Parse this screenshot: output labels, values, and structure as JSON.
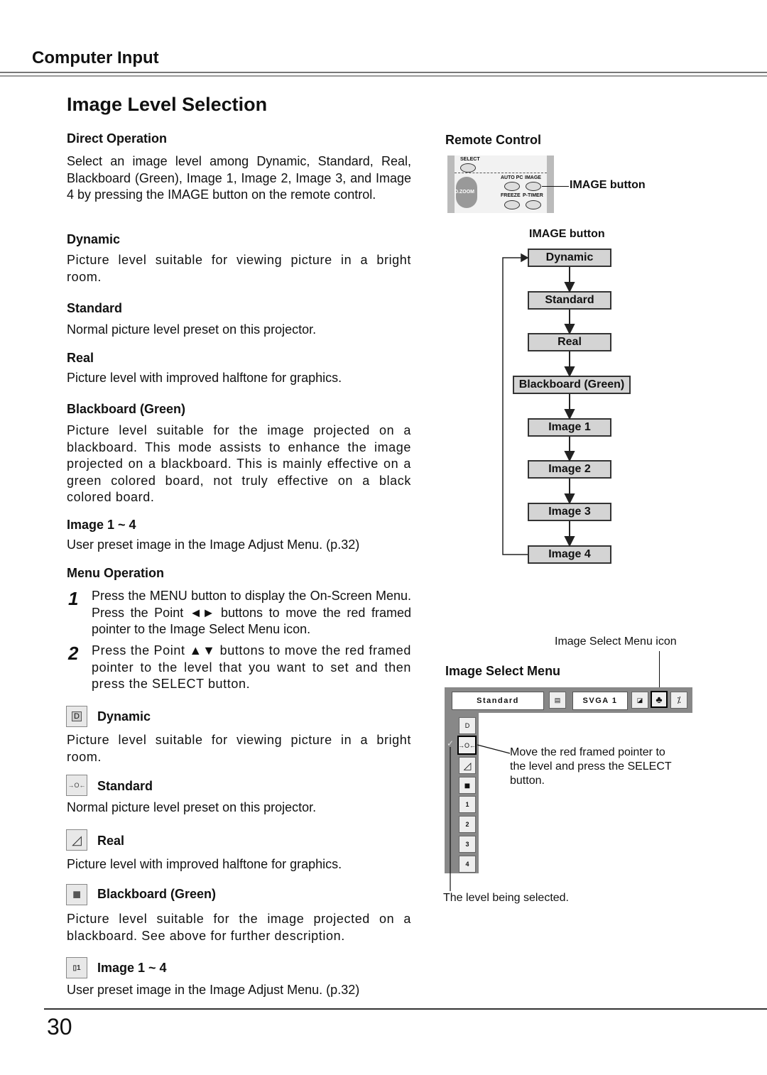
{
  "header": {
    "section": "Computer Input",
    "title": "Image Level Selection"
  },
  "direct": {
    "heading": "Direct Operation",
    "intro": "Select an image level among Dynamic, Standard, Real, Blackboard (Green), Image 1, Image 2, Image 3, and Image 4 by pressing the IMAGE button on the remote control.",
    "items": [
      {
        "name": "Dynamic",
        "desc": "Picture level suitable for viewing picture in a bright room."
      },
      {
        "name": "Standard",
        "desc": "Normal picture level preset on this projector."
      },
      {
        "name": "Real",
        "desc": "Picture level with improved halftone for graphics."
      },
      {
        "name": "Blackboard (Green)",
        "desc": "Picture level suitable for the image projected on a blackboard. This mode assists to enhance the image projected on a blackboard. This is mainly effective on a green colored board, not truly effective on a black colored board."
      },
      {
        "name": "Image 1 ~ 4",
        "desc": "User preset image in the Image Adjust Menu. (p.32)"
      }
    ]
  },
  "menu_op": {
    "heading": "Menu Operation",
    "steps": [
      {
        "num": "1",
        "text": "Press the MENU button to display the On-Screen Menu.  Press the Point ◄► buttons to move the red framed pointer to the Image Select Menu icon."
      },
      {
        "num": "2",
        "text": "Press the Point ▲▼ buttons to move the red framed pointer to the level that you want to set and then press the SELECT button."
      }
    ],
    "items": [
      {
        "name": "Dynamic",
        "icon": "dynamic-icon",
        "glyph": "D",
        "desc": "Picture level suitable for viewing picture in a bright room."
      },
      {
        "name": "Standard",
        "icon": "standard-icon",
        "glyph": "→O←",
        "desc": "Normal picture level preset on this projector."
      },
      {
        "name": "Real",
        "icon": "real-icon",
        "glyph": "◿",
        "desc": "Picture level with improved halftone for graphics."
      },
      {
        "name": "Blackboard (Green)",
        "icon": "blackboard-icon",
        "glyph": "■",
        "desc": "Picture level suitable for the image projected on a blackboard.  See above for further description."
      },
      {
        "name": "Image 1 ~ 4",
        "icon": "image-preset-icon",
        "glyph": "▯1",
        "desc": "User preset image in the Image Adjust Menu. (p.32)"
      }
    ]
  },
  "remote": {
    "heading": "Remote Control",
    "labels": [
      "SELECT",
      "AUTO PC",
      "IMAGE",
      "D.ZOOM",
      "FREEZE",
      "P-TIMER"
    ],
    "callout": "IMAGE button"
  },
  "flow": {
    "heading": "IMAGE button",
    "steps": [
      "Dynamic",
      "Standard",
      "Real",
      "Blackboard (Green)",
      "Image 1",
      "Image 2",
      "Image 3",
      "Image 4"
    ]
  },
  "osd": {
    "heading": "Image Select Menu",
    "icon_callout": "Image Select Menu icon",
    "mode_field": "Standard",
    "signal_field": "SVGA 1",
    "side_items": [
      "D",
      "→O←",
      "◿",
      "■",
      "1",
      "2",
      "3",
      "4"
    ],
    "pointer_callout": "Move the red framed pointer to the level and press the SELECT button.",
    "selected_callout": "The level being selected."
  },
  "footer": {
    "page": "30"
  }
}
